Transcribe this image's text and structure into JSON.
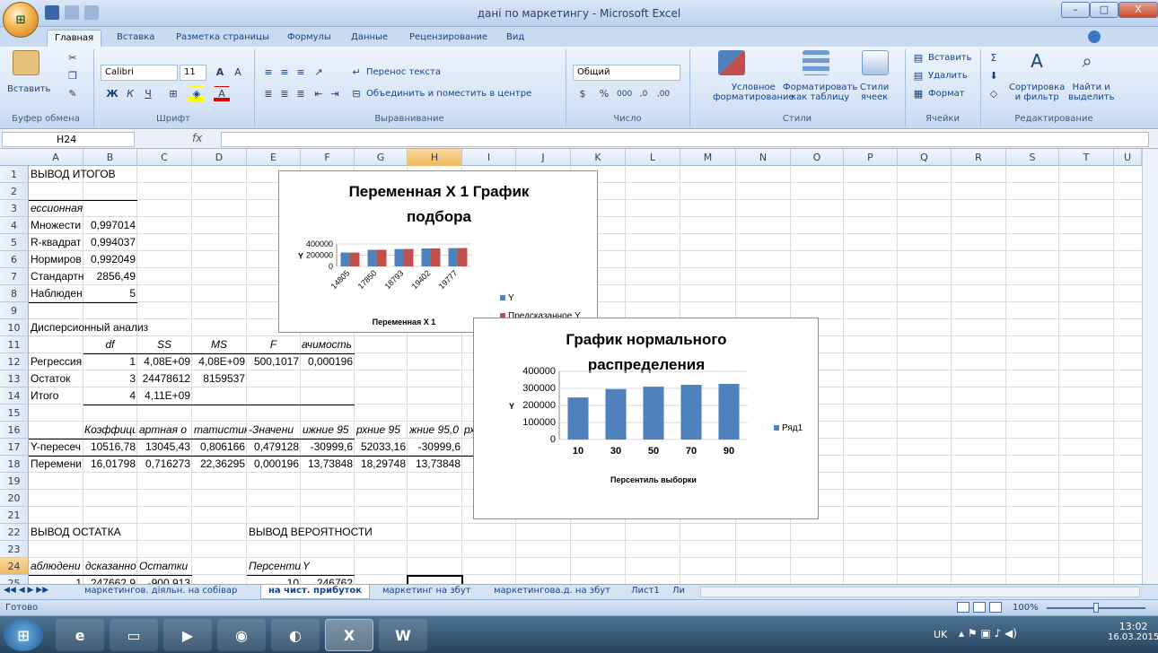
{
  "app": {
    "title": "дані по маркетингу - Microsoft Excel",
    "office_glyph": "⊞"
  },
  "window": {
    "minimize": "–",
    "maximize": "□",
    "close": "X"
  },
  "tabs": [
    "Главная",
    "Вставка",
    "Разметка страницы",
    "Формулы",
    "Данные",
    "Рецензирование",
    "Вид"
  ],
  "ribbon": {
    "paste": "Вставить",
    "font_name": "Calibri",
    "font_size": "11",
    "wrap_text": "Перенос текста",
    "merge_center": "Объединить и поместить в центре",
    "number_format": "Общий",
    "cond_format": [
      "Условное",
      "форматирование"
    ],
    "format_table": [
      "Форматировать",
      "как таблицу"
    ],
    "cell_styles": [
      "Стили",
      "ячеек"
    ],
    "insert": "Вставить",
    "delete": "Удалить",
    "format": "Формат",
    "sort": [
      "Сортировка",
      "и фильтр"
    ],
    "find": [
      "Найти и",
      "выделить"
    ],
    "groups": [
      "Буфер обмена",
      "Шрифт",
      "Выравнивание",
      "Число",
      "Стили",
      "Ячейки",
      "Редактирование"
    ]
  },
  "formula_bar": {
    "name_box": "H24",
    "fx": "fx",
    "value": ""
  },
  "columns": [
    "A",
    "B",
    "C",
    "D",
    "E",
    "F",
    "G",
    "H",
    "I",
    "J",
    "K",
    "L",
    "M",
    "N",
    "O",
    "P",
    "Q",
    "R",
    "S",
    "T",
    "U"
  ],
  "rows": [
    "1",
    "2",
    "3",
    "4",
    "5",
    "6",
    "7",
    "8",
    "9",
    "10",
    "11",
    "12",
    "13",
    "14",
    "15",
    "16",
    "17",
    "18",
    "19",
    "20",
    "21",
    "22",
    "23",
    "24",
    "25"
  ],
  "cells": {
    "A1": "ВЫВОД ИТОГОВ",
    "A3": "ессионная статистика",
    "A4": "Множести",
    "B4": "0,997014",
    "A5": "R-квадрат",
    "B5": "0,994037",
    "A6": "Нормиров",
    "B6": "0,992049",
    "A7": "Стандартн",
    "B7": "2856,49",
    "A8": "Наблюден",
    "B8": "5",
    "A10": "Дисперсионный анализ",
    "B11": "df",
    "C11": "SS",
    "D11": "MS",
    "E11": "F",
    "F11": "ачимость F",
    "A12": "Регрессия",
    "B12": "1",
    "C12": "4,08E+09",
    "D12": "4,08E+09",
    "E12": "500,1017",
    "F12": "0,000196",
    "A13": "Остаток",
    "B13": "3",
    "C13": "24478612",
    "D13": "8159537",
    "A14": "Итого",
    "B14": "4",
    "C14": "4,11E+09",
    "B16": "Коэффициен",
    "C16": "артная о",
    "D16": "татистик",
    "E16": "-Значени",
    "F16": "ижние 95",
    "G16": "рхние 95",
    "H16": "жние 95,0",
    "I16": "рх",
    "A17": "Y-пересеч",
    "B17": "10516,78",
    "C17": "13045,43",
    "D17": "0,806166",
    "E17": "0,479128",
    "F17": "-30999,6",
    "G17": "52033,16",
    "H17": "-30999,6",
    "I17": "5",
    "A18": "Перемени",
    "B18": "16,01798",
    "C18": "0,716273",
    "D18": "22,36295",
    "E18": "0,000196",
    "F18": "13,73848",
    "G18": "18,29748",
    "H18": "13,73848",
    "I18": "1",
    "A22": "ВЫВОД ОСТАТКА",
    "E22": "ВЫВОД ВЕРОЯТНОСТИ",
    "A24": "аблюдени",
    "B24": "дсказанно",
    "C24": "Остатки",
    "E24": "Персентил",
    "F24": "Y",
    "A25": "1",
    "B25": "247662.9",
    "C25": "-900.913",
    "E25": "10",
    "F25": "246762"
  },
  "chart_data": [
    {
      "type": "bar",
      "title": "Переменная X 1 График подбора",
      "xlabel": "Переменная X 1",
      "ylabel": "Y",
      "categories": [
        "14805",
        "17850",
        "18793",
        "19402",
        "19777"
      ],
      "series": [
        {
          "name": "Y",
          "color": "#4f81bd",
          "values": [
            246762,
            296000,
            310000,
            321000,
            326000
          ]
        },
        {
          "name": "Предсказанное Y",
          "color": "#c0504d",
          "values": [
            247662.9,
            296440,
            311540,
            321290,
            327300
          ]
        }
      ],
      "y_ticks": [
        "400000",
        "200000",
        "0"
      ],
      "ylim": [
        0,
        400000
      ],
      "legend": "right"
    },
    {
      "type": "bar",
      "title": "График нормального распределения",
      "xlabel": "Персентиль выборки",
      "ylabel": "Y",
      "categories": [
        "10",
        "30",
        "50",
        "70",
        "90"
      ],
      "series": [
        {
          "name": "Ряд1",
          "color": "#4f81bd",
          "values": [
            246762,
            296000,
            310000,
            321000,
            326000
          ]
        }
      ],
      "y_ticks": [
        "400000",
        "300000",
        "200000",
        "100000",
        "0"
      ],
      "ylim": [
        0,
        400000
      ],
      "legend": "right"
    }
  ],
  "sheets": [
    "маркетингов. діяльн. на собівар",
    "на чист. прибуток",
    "маркетинг на збут",
    "маркетингова.д. на збут",
    "Лист1",
    "Ли"
  ],
  "status": {
    "ready": "Готово",
    "zoom": "100%"
  },
  "taskbar": {
    "lang": "UK",
    "time": "13:02",
    "date": "16.03.2015"
  }
}
